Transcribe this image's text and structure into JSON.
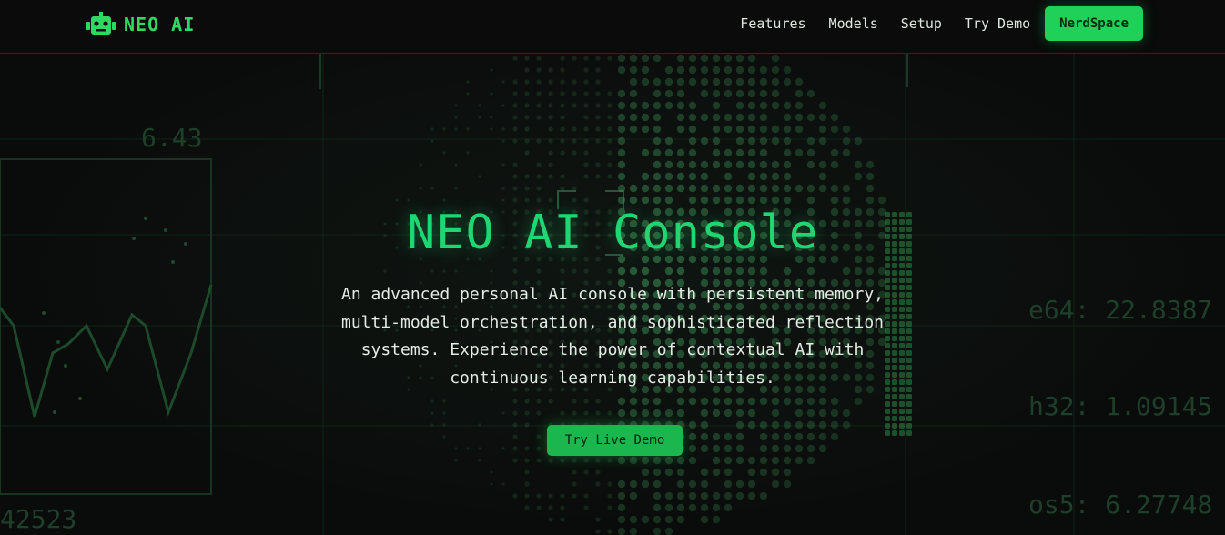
{
  "nav": {
    "brand": "NEO AI",
    "links": [
      "Features",
      "Models",
      "Setup",
      "Try Demo"
    ],
    "cta": "NerdSpace"
  },
  "hero": {
    "title": "NEO AI Console",
    "description": "An advanced personal AI console with persistent memory, multi-model orchestration, and sophisticated reflection systems. Experience the power of contextual AI with continuous learning capabilities.",
    "cta": "Try Live Demo"
  },
  "background": {
    "readouts": [
      "6.43",
      "42523",
      "e64: 22.8387",
      "h32: 1.09145",
      "os5: 6.27748"
    ]
  },
  "colors": {
    "accent": "#1fd158",
    "title": "#1fd672",
    "background": "#0b0c0b",
    "matrix_dim": "#1e3f2a"
  }
}
